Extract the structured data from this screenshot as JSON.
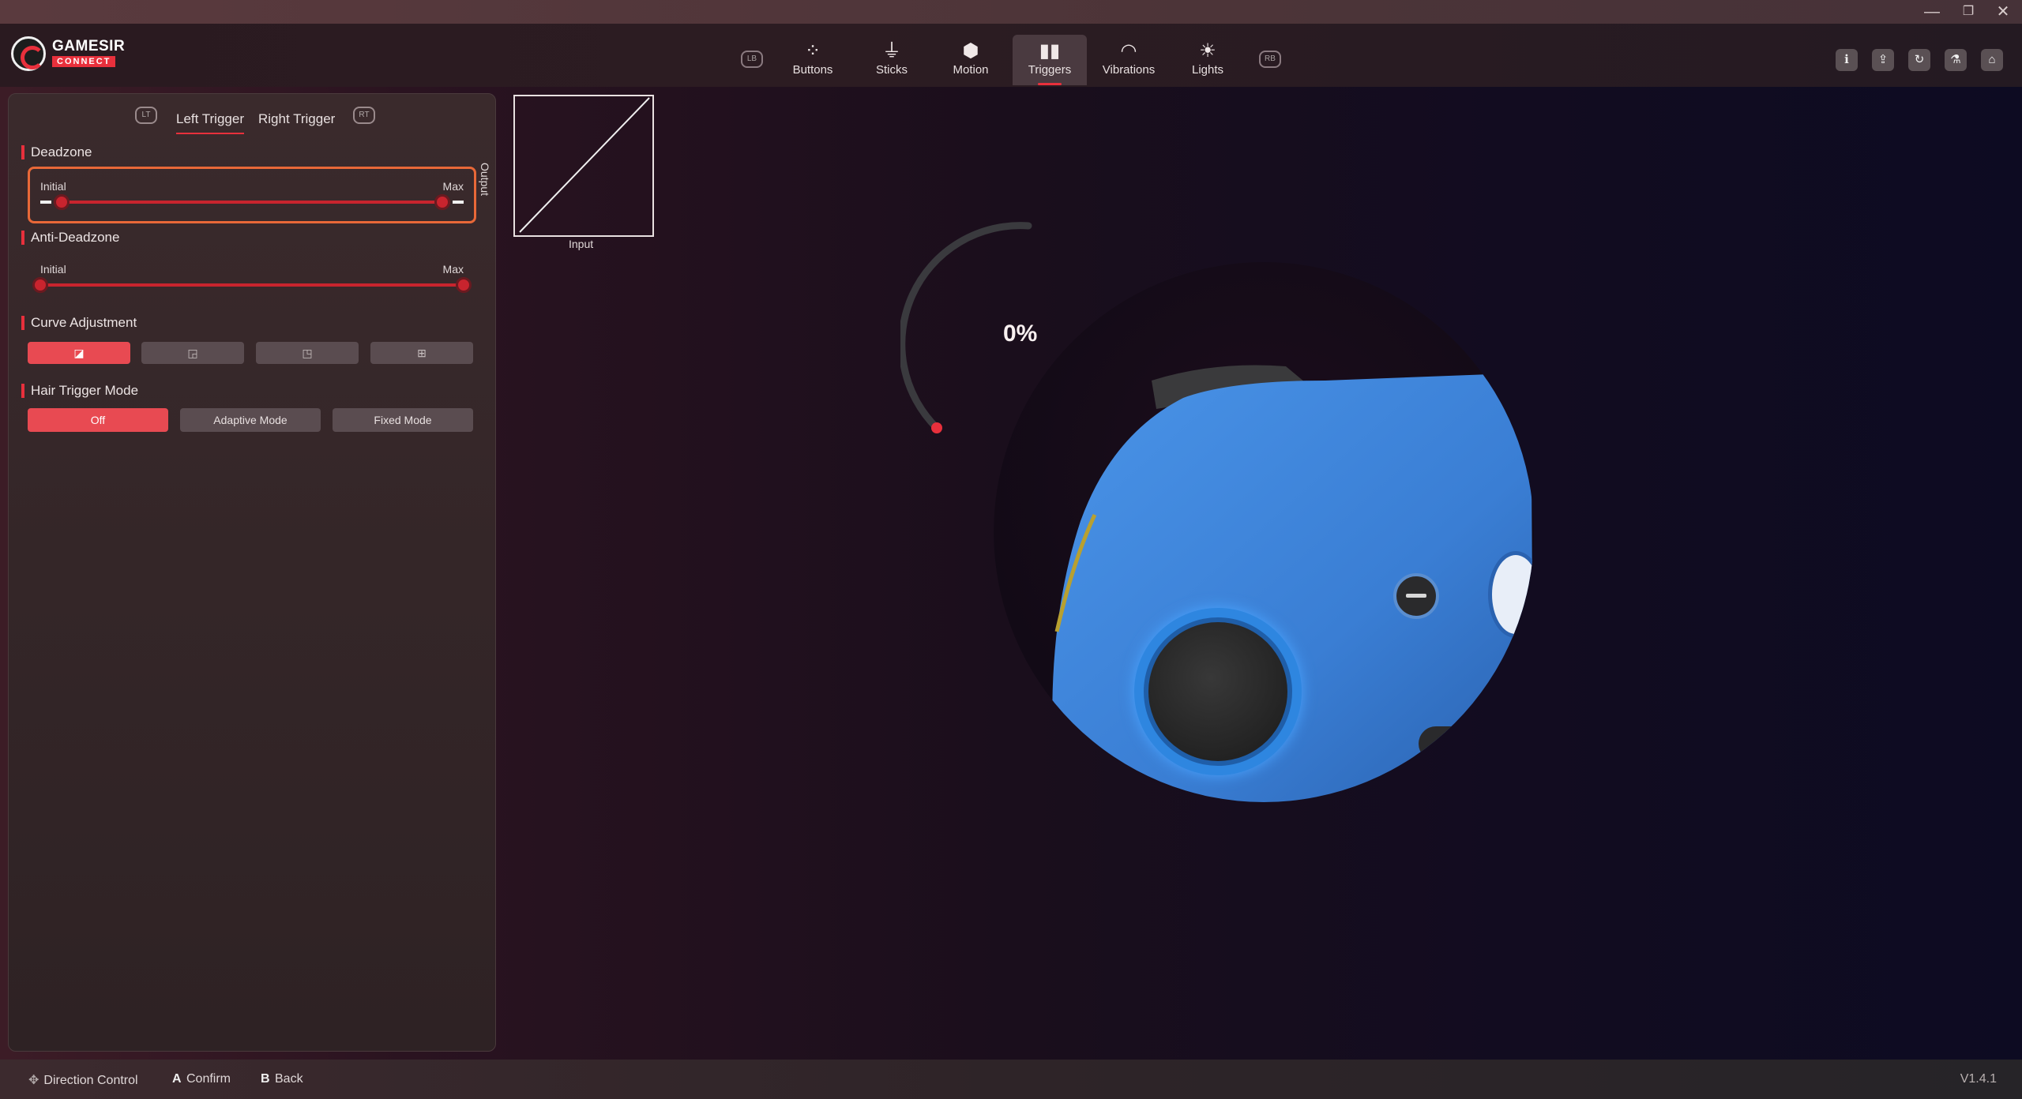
{
  "window": {
    "controls": {
      "minimize": "—",
      "restore": "❐",
      "close": "✕"
    }
  },
  "app": {
    "logo_text": "GAMESIR",
    "logo_sub": "CONNECT"
  },
  "nav": {
    "left_bumper": "LB",
    "right_bumper": "RB",
    "items": [
      {
        "label": "Buttons",
        "icon": "buttons-icon"
      },
      {
        "label": "Sticks",
        "icon": "sticks-icon"
      },
      {
        "label": "Motion",
        "icon": "motion-icon"
      },
      {
        "label": "Triggers",
        "icon": "triggers-icon",
        "active": true
      },
      {
        "label": "Vibrations",
        "icon": "vibrations-icon"
      },
      {
        "label": "Lights",
        "icon": "lights-icon"
      }
    ],
    "tools": [
      "info-icon",
      "upload-icon",
      "reset-icon",
      "test-icon",
      "home-icon"
    ]
  },
  "triggers": {
    "left_tag": "LT",
    "right_tag": "RT",
    "tabs": [
      {
        "label": "Left Trigger",
        "active": true
      },
      {
        "label": "Right Trigger",
        "active": false
      }
    ]
  },
  "deadzone": {
    "title": "Deadzone",
    "initial_label": "Initial",
    "max_label": "Max",
    "initial_value": 0.05,
    "max_value": 0.95
  },
  "anti_deadzone": {
    "title": "Anti-Deadzone",
    "initial_label": "Initial",
    "max_label": "Max",
    "initial_value": 0,
    "max_value": 1
  },
  "curve": {
    "title": "Curve Adjustment",
    "options": [
      "linear-curve-icon",
      "concave-curve-icon",
      "convex-curve-icon",
      "custom-curve-icon"
    ],
    "selected": 0
  },
  "hair_trigger": {
    "title": "Hair Trigger Mode",
    "options": [
      "Off",
      "Adaptive Mode",
      "Fixed Mode"
    ],
    "selected": 0
  },
  "graph": {
    "xlabel": "Input",
    "ylabel": "Output"
  },
  "gauge": {
    "value_text": "0%",
    "value": 0
  },
  "footer": {
    "direction_label": "Direction Control",
    "confirm_key": "A",
    "confirm_label": "Confirm",
    "back_key": "B",
    "back_label": "Back",
    "version": "V1.4.1"
  },
  "colors": {
    "accent": "#e8303c",
    "controller_blue": "#3a82d8",
    "focus_outline": "#e86838"
  }
}
